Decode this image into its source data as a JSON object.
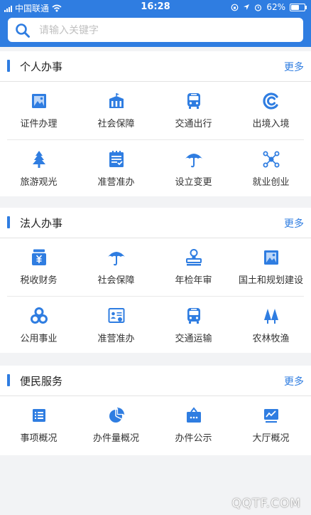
{
  "status": {
    "carrier": "中国联通",
    "time": "16:28",
    "battery": "62%"
  },
  "search": {
    "placeholder": "请输入关键字"
  },
  "sections": [
    {
      "title": "个人办事",
      "more": "更多",
      "items": [
        {
          "label": "证件办理",
          "icon": "id-card-icon"
        },
        {
          "label": "社会保障",
          "icon": "building-icon"
        },
        {
          "label": "交通出行",
          "icon": "bus-icon"
        },
        {
          "label": "出境入境",
          "icon": "exit-entry-icon"
        },
        {
          "label": "旅游观光",
          "icon": "tree-icon"
        },
        {
          "label": "准营准办",
          "icon": "checklist-icon"
        },
        {
          "label": "设立变更",
          "icon": "umbrella-icon"
        },
        {
          "label": "就业创业",
          "icon": "network-icon"
        }
      ]
    },
    {
      "title": "法人办事",
      "more": "更多",
      "items": [
        {
          "label": "税收财务",
          "icon": "tax-icon"
        },
        {
          "label": "社会保障",
          "icon": "umbrella-icon"
        },
        {
          "label": "年检年审",
          "icon": "stamp-icon"
        },
        {
          "label": "国土和规划建设",
          "icon": "landscape-icon"
        },
        {
          "label": "公用事业",
          "icon": "rings-icon"
        },
        {
          "label": "准营准办",
          "icon": "certificate-icon"
        },
        {
          "label": "交通运输",
          "icon": "bus-icon"
        },
        {
          "label": "农林牧渔",
          "icon": "forest-icon"
        }
      ]
    },
    {
      "title": "便民服务",
      "more": "更多",
      "items": [
        {
          "label": "事项概况",
          "icon": "list-icon"
        },
        {
          "label": "办件量概况",
          "icon": "pie-chart-icon"
        },
        {
          "label": "办件公示",
          "icon": "notice-box-icon"
        },
        {
          "label": "大厅概况",
          "icon": "line-chart-icon"
        }
      ]
    }
  ],
  "watermark": "QQTF.COM",
  "colors": {
    "accent": "#2f7de1",
    "background": "#f2f3f5"
  }
}
